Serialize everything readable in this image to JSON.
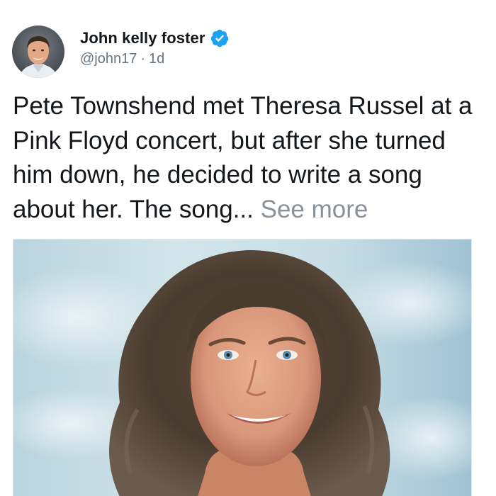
{
  "author": {
    "display_name": "John kelly foster",
    "handle": "@john17",
    "separator": "·",
    "timestamp": "1d",
    "verified": true,
    "avatar_icon": "user-avatar-photo"
  },
  "tweet": {
    "text": "Pete Townshend met Theresa Russel at a Pink Floyd concert, but after she turned him down, he decided to write a song about her. The song...",
    "see_more_label": "See more"
  },
  "media": {
    "type": "photo",
    "description_icon": "portrait-photo"
  },
  "colors": {
    "verified_badge": "#1da1f2",
    "text_primary": "#14171a",
    "text_secondary": "#657786",
    "see_more": "#8a9199"
  }
}
